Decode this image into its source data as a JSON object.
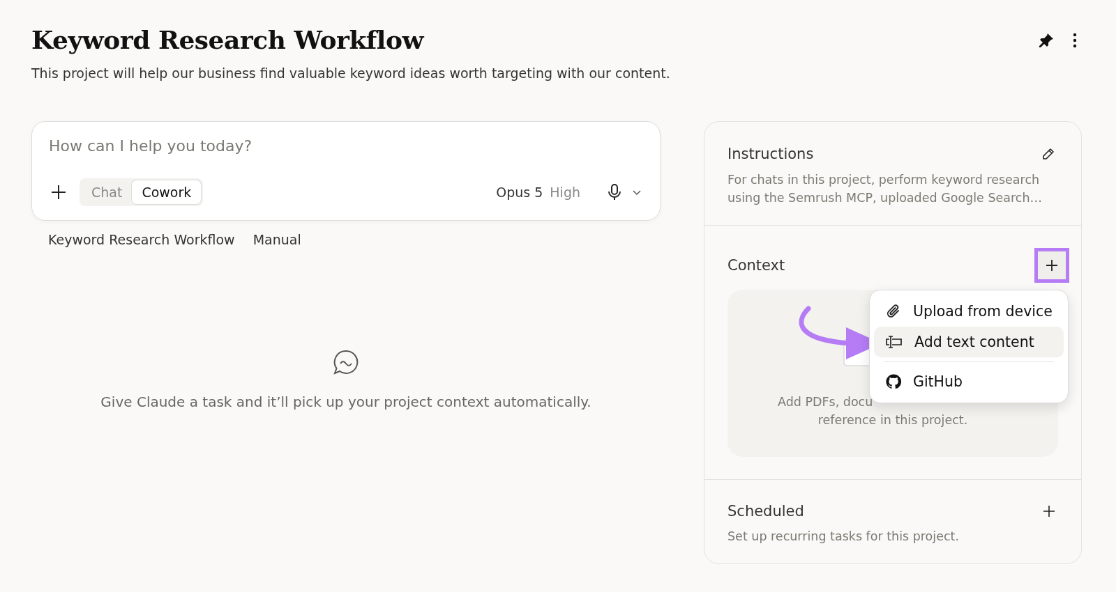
{
  "project": {
    "title": "Keyword Research Workflow",
    "description": "This project will help our business find valuable keyword ideas worth targeting with our content."
  },
  "composer": {
    "placeholder": "How can I help you today?",
    "modes": [
      {
        "label": "Chat",
        "selected": false
      },
      {
        "label": "Cowork",
        "selected": true
      }
    ],
    "model": "Opus 5",
    "effort": "High"
  },
  "meta": [
    "Keyword Research Workflow",
    "Manual"
  ],
  "empty_state": "Give Claude a task and it’ll pick up your project context automatically.",
  "instructions": {
    "title": "Instructions",
    "text": "For chats in this project, perform keyword research using the Semrush MCP, uploaded Google Search…"
  },
  "context": {
    "title": "Context",
    "dropzone_lines": [
      "Add PDFs, docu",
      "reference in this project."
    ],
    "menu": [
      {
        "label": "Upload from device",
        "kind": "paperclip",
        "selected": false
      },
      {
        "label": "Add text content",
        "kind": "text",
        "selected": true
      },
      {
        "label": "GitHub",
        "kind": "github",
        "selected": false
      }
    ]
  },
  "scheduled": {
    "title": "Scheduled",
    "text": "Set up recurring tasks for this project."
  }
}
